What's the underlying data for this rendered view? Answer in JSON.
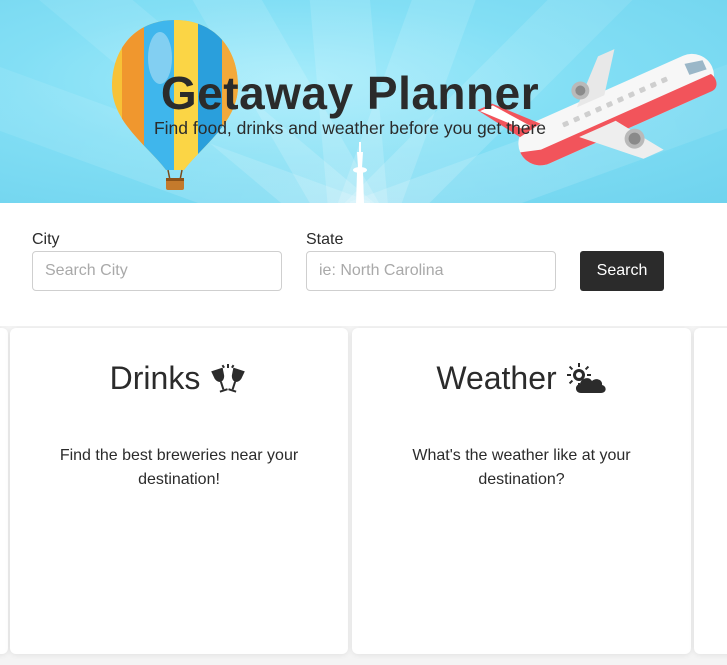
{
  "hero": {
    "title": "Getaway Planner",
    "subtitle": "Find food, drinks and weather before you get there",
    "decorations": [
      "hot-air-balloon",
      "airplane",
      "tower"
    ]
  },
  "search": {
    "city_label": "City",
    "city_placeholder": "Search City",
    "city_value": "",
    "state_label": "State",
    "state_placeholder": "ie: North Carolina",
    "state_value": "",
    "button_label": "Search"
  },
  "cards": [
    {
      "title": "Drinks",
      "icon": "clinking-glasses-icon",
      "description": "Find the best breweries near your destination!"
    },
    {
      "title": "Weather",
      "icon": "sun-behind-cloud-icon",
      "description": "What's the weather like at your destination?"
    }
  ],
  "colors": {
    "hero_sky": "#83dff5",
    "text": "#2b2b2b",
    "button_bg": "#2b2b2b",
    "plane_red": "#f2545b"
  }
}
